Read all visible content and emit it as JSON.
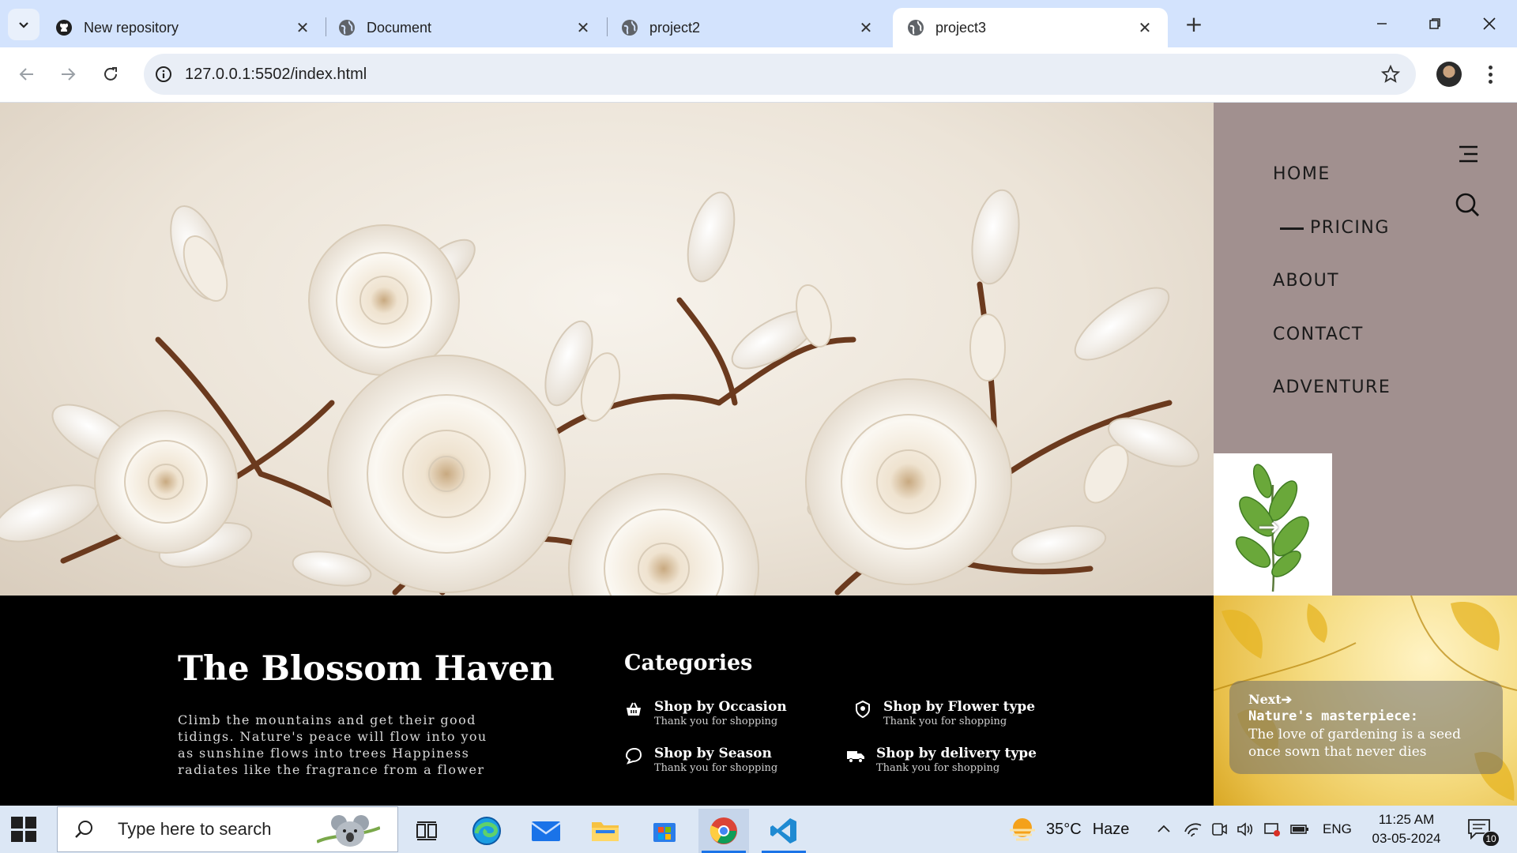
{
  "browser": {
    "tabs": [
      {
        "label": "New repository",
        "favicon": "github-icon",
        "active": false
      },
      {
        "label": "Document",
        "favicon": "globe-icon",
        "active": false
      },
      {
        "label": "project2",
        "favicon": "globe-icon",
        "active": false
      },
      {
        "label": "project3",
        "favicon": "globe-icon",
        "active": true
      }
    ],
    "url": "127.0.0.1:5502/index.html"
  },
  "site": {
    "nav": {
      "items": [
        "HOME",
        "PRICING",
        "ABOUT",
        "CONTACT",
        "ADVENTURE"
      ],
      "active": "PRICING"
    },
    "footer": {
      "brand_title": "The Blossom Haven",
      "brand_text": "Climb the mountains and get their good tidings. Nature's peace will flow into you as sunshine flows into trees Happiness radiates like the fragrance from a flower",
      "categories_title": "Categories",
      "categories": [
        {
          "name": "Shop by Occasion",
          "sub": "Thank you for shopping",
          "icon": "basket-icon"
        },
        {
          "name": "Shop by Flower type",
          "sub": "Thank you for shopping",
          "icon": "flower-badge-icon"
        },
        {
          "name": "Shop by Season",
          "sub": "Thank you for shopping",
          "icon": "tag-icon"
        },
        {
          "name": "Shop by delivery type",
          "sub": "Thank you for shopping",
          "icon": "truck-icon"
        }
      ]
    },
    "promo": {
      "next": "Next",
      "heading": "Nature's masterpiece:",
      "text": "The love of gardening is a seed once sown that never dies"
    }
  },
  "taskbar": {
    "search_placeholder": "Type here to search",
    "weather": {
      "temp": "35°C",
      "condition": "Haze"
    },
    "language": "ENG",
    "time": "11:25 AM",
    "date": "03-05-2024",
    "notifications": "10"
  },
  "colors": {
    "sidepanel": "#a1908f",
    "footer": "#000000",
    "tabstrip": "#d3e3fd"
  }
}
